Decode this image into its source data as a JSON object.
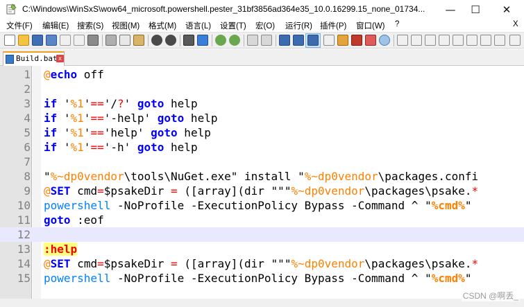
{
  "window": {
    "title": "C:\\Windows\\WinSxS\\wow64_microsoft.powershell.pester_31bf3856ad364e35_10.0.16299.15_none_01734...",
    "minimize": "—",
    "maximize": "☐",
    "close": "✕"
  },
  "menu": [
    "文件(F)",
    "编辑(E)",
    "搜索(S)",
    "视图(M)",
    "格式(M)",
    "语言(L)",
    "设置(T)",
    "宏(O)",
    "运行(R)",
    "插件(P)",
    "窗口(W)",
    "?",
    "X"
  ],
  "tab": {
    "label": "Build.bat",
    "close": "x"
  },
  "editor": {
    "lines": [
      {
        "n": "1",
        "tokens": [
          [
            "at",
            "@"
          ],
          [
            "kw",
            "echo"
          ],
          [
            "t",
            " off"
          ]
        ]
      },
      {
        "n": "2",
        "tokens": []
      },
      {
        "n": "3",
        "tokens": [
          [
            "kw",
            "if"
          ],
          [
            "t",
            " '"
          ],
          [
            "var",
            "%1"
          ],
          [
            "t",
            "'"
          ],
          [
            "op",
            "=="
          ],
          [
            "t",
            "'/"
          ],
          [
            "op",
            "?"
          ],
          [
            "t",
            "' "
          ],
          [
            "kw",
            "goto"
          ],
          [
            "t",
            " help"
          ]
        ]
      },
      {
        "n": "4",
        "tokens": [
          [
            "kw",
            "if"
          ],
          [
            "t",
            " '"
          ],
          [
            "var",
            "%1"
          ],
          [
            "t",
            "'"
          ],
          [
            "op",
            "=="
          ],
          [
            "t",
            "'-help' "
          ],
          [
            "kw",
            "goto"
          ],
          [
            "t",
            " help"
          ]
        ]
      },
      {
        "n": "5",
        "tokens": [
          [
            "kw",
            "if"
          ],
          [
            "t",
            " '"
          ],
          [
            "var",
            "%1"
          ],
          [
            "t",
            "'"
          ],
          [
            "op",
            "=="
          ],
          [
            "t",
            "'help' "
          ],
          [
            "kw",
            "goto"
          ],
          [
            "t",
            " help"
          ]
        ]
      },
      {
        "n": "6",
        "tokens": [
          [
            "kw",
            "if"
          ],
          [
            "t",
            " '"
          ],
          [
            "var",
            "%1"
          ],
          [
            "t",
            "'"
          ],
          [
            "op",
            "=="
          ],
          [
            "t",
            "'-h' "
          ],
          [
            "kw",
            "goto"
          ],
          [
            "t",
            " help"
          ]
        ]
      },
      {
        "n": "7",
        "tokens": []
      },
      {
        "n": "8",
        "tokens": [
          [
            "t",
            "\""
          ],
          [
            "var",
            "%~dp0vendor"
          ],
          [
            "t",
            "\\tools\\NuGet.exe\" install \""
          ],
          [
            "var",
            "%~dp0vendor"
          ],
          [
            "t",
            "\\packages.confi"
          ]
        ]
      },
      {
        "n": "9",
        "tokens": [
          [
            "at",
            "@"
          ],
          [
            "set",
            "SET"
          ],
          [
            "t",
            " cmd"
          ],
          [
            "op",
            "="
          ],
          [
            "t",
            "$psakeDir "
          ],
          [
            "op",
            "="
          ],
          [
            "t",
            " ([array](dir \"\"\""
          ],
          [
            "var",
            "%~dp0vendor"
          ],
          [
            "t",
            "\\packages\\psake."
          ],
          [
            "op",
            "*"
          ]
        ]
      },
      {
        "n": "10",
        "tokens": [
          [
            "cmd",
            "powershell"
          ],
          [
            "t",
            " -NoProfile -ExecutionPolicy Bypass -Command ^ \""
          ],
          [
            "bvar",
            "%cmd%"
          ],
          [
            "t",
            "\""
          ]
        ]
      },
      {
        "n": "11",
        "tokens": [
          [
            "kw",
            "goto"
          ],
          [
            "t",
            " :eof"
          ]
        ]
      },
      {
        "n": "12",
        "tokens": [],
        "current": true
      },
      {
        "n": "13",
        "tokens": [
          [
            "lbl",
            ":help"
          ]
        ]
      },
      {
        "n": "14",
        "tokens": [
          [
            "at",
            "@"
          ],
          [
            "set",
            "SET"
          ],
          [
            "t",
            " cmd"
          ],
          [
            "op",
            "="
          ],
          [
            "t",
            "$psakeDir "
          ],
          [
            "op",
            "="
          ],
          [
            "t",
            " ([array](dir \"\"\""
          ],
          [
            "var",
            "%~dp0vendor"
          ],
          [
            "t",
            "\\packages\\psake."
          ],
          [
            "op",
            "*"
          ]
        ]
      },
      {
        "n": "15",
        "tokens": [
          [
            "cmd",
            "powershell"
          ],
          [
            "t",
            " -NoProfile -ExecutionPolicy Bypass -Command ^ \""
          ],
          [
            "bvar",
            "%cmd%"
          ],
          [
            "t",
            "\""
          ]
        ]
      }
    ]
  },
  "watermark": "CSDN @啊丢_"
}
